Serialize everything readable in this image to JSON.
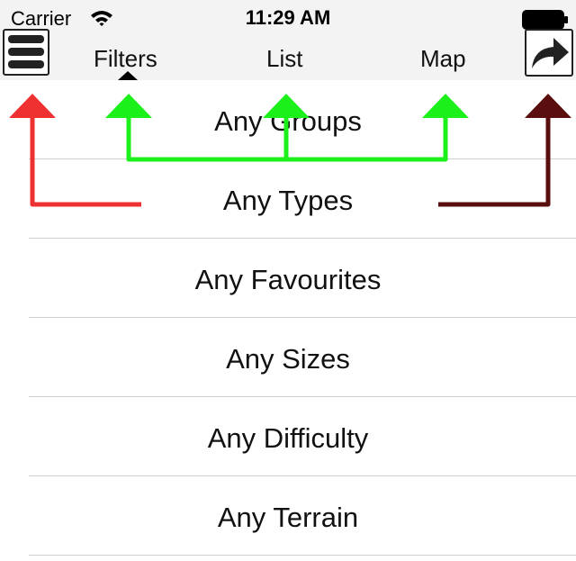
{
  "status_bar": {
    "carrier": "Carrier",
    "time": "11:29 AM",
    "wifi_icon": "wifi-icon",
    "battery_icon": "battery-icon"
  },
  "nav": {
    "menu_icon": "hamburger-menu-icon",
    "share_icon": "share-arrow-icon",
    "tabs": [
      {
        "label": "Filters",
        "selected": true
      },
      {
        "label": "List",
        "selected": false
      },
      {
        "label": "Map",
        "selected": false
      }
    ]
  },
  "filters": [
    {
      "label": "Any Groups"
    },
    {
      "label": "Any Types"
    },
    {
      "label": "Any Favourites"
    },
    {
      "label": "Any Sizes"
    },
    {
      "label": "Any Difficulty"
    },
    {
      "label": "Any Terrain"
    }
  ],
  "annotation_colors": {
    "red": "#ef3030",
    "green": "#1bf01b",
    "dark_red": "#5a0e0e"
  }
}
